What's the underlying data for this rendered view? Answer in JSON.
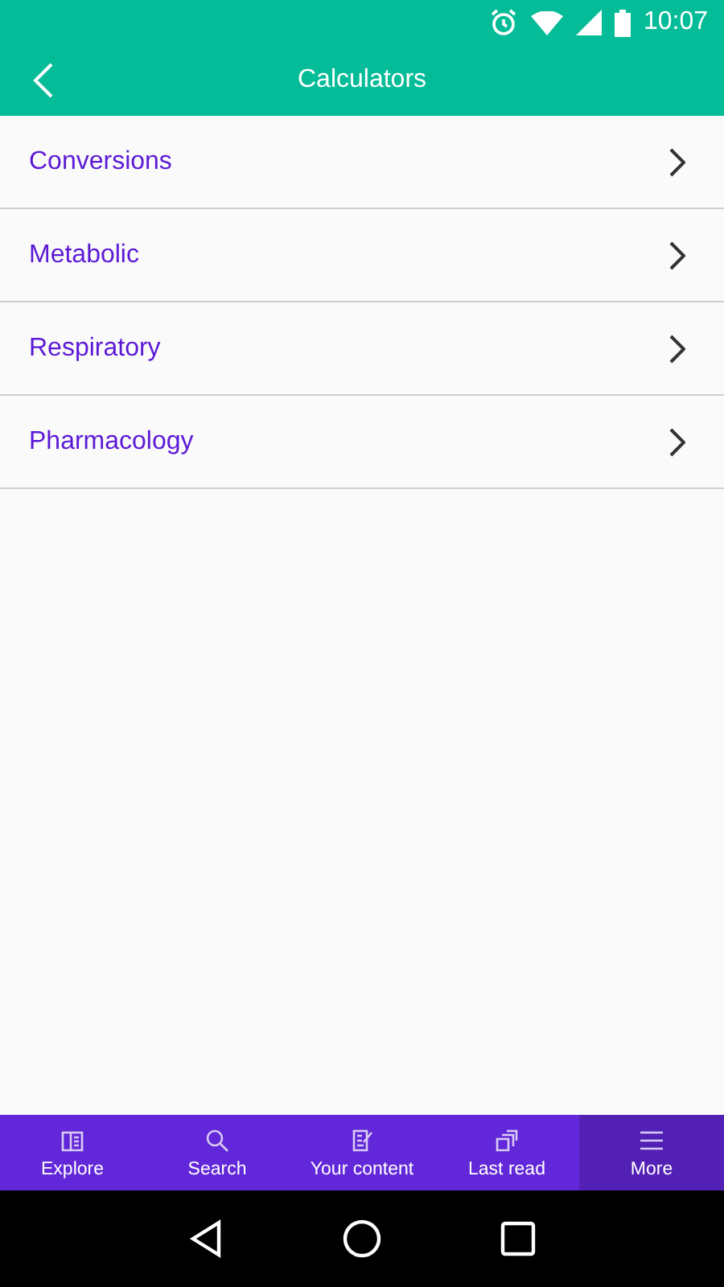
{
  "status_bar": {
    "time": "10:07"
  },
  "app_bar": {
    "title": "Calculators"
  },
  "list": [
    {
      "label": "Conversions"
    },
    {
      "label": "Metabolic"
    },
    {
      "label": "Respiratory"
    },
    {
      "label": "Pharmacology"
    }
  ],
  "bottom_nav": [
    {
      "label": "Explore",
      "kind": "book",
      "selected": false
    },
    {
      "label": "Search",
      "kind": "search",
      "selected": false
    },
    {
      "label": "Your content",
      "kind": "notes",
      "selected": false
    },
    {
      "label": "Last read",
      "kind": "stack",
      "selected": false
    },
    {
      "label": "More",
      "kind": "menu",
      "selected": true
    }
  ]
}
